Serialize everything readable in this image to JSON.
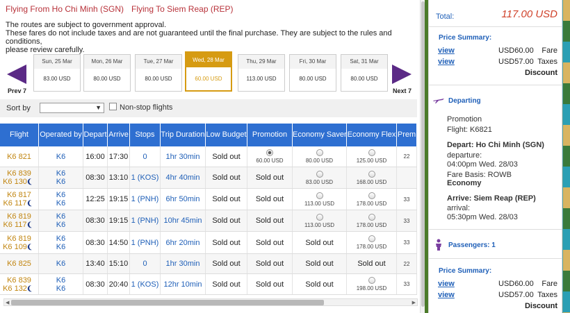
{
  "header": {
    "flying_from": "Flying From Ho Chi Minh (SGN)",
    "flying_to": "Flying To Siem Reap (REP)"
  },
  "notes": [
    "The routes are subject to government approval.",
    "These fares do not include taxes and are not guaranteed until the final purchase. They are subject to the rules and conditions,",
    "please review carefully."
  ],
  "date_nav": {
    "prev_label": "Prev 7",
    "next_label": "Next 7"
  },
  "dates": [
    {
      "day": "Sun, 25 Mar",
      "price": "83.00 USD"
    },
    {
      "day": "Mon, 26 Mar",
      "price": "80.00 USD"
    },
    {
      "day": "Tue, 27 Mar",
      "price": "80.00 USD"
    },
    {
      "day": "Wed, 28 Mar",
      "price": "60.00 USD",
      "selected": true
    },
    {
      "day": "Thu, 29 Mar",
      "price": "113.00 USD"
    },
    {
      "day": "Fri, 30 Mar",
      "price": "80.00 USD"
    },
    {
      "day": "Sat, 31 Mar",
      "price": "80.00 USD"
    }
  ],
  "sort": {
    "label": "Sort by",
    "value": "",
    "nonstop_label": "Non-stop flights"
  },
  "table": {
    "columns": [
      "Flight",
      "Operated by",
      "Depart",
      "Arrive",
      "Stops",
      "Trip Duration",
      "Low Budget",
      "Promotion",
      "Economy Saver",
      "Economy Flex",
      "Prem"
    ],
    "rows": [
      {
        "flights": [
          "K6 821"
        ],
        "ops": [
          "K6"
        ],
        "depart": "16:00",
        "arrive": "17:30",
        "stops": "0",
        "duration": "1hr 30min",
        "low": "Sold out",
        "promo": {
          "radio": "on",
          "price": "60.00 USD"
        },
        "saver": {
          "radio": "off",
          "price": "80.00 USD"
        },
        "flex": {
          "radio": "off",
          "price": "125.00 USD"
        },
        "prem": "22"
      },
      {
        "flights": [
          "K6 839",
          "K6 130"
        ],
        "night": [
          false,
          true
        ],
        "ops": [
          "K6",
          "K6"
        ],
        "depart": "08:30",
        "arrive": "13:10",
        "stops": "1 (KOS)",
        "duration": "4hr 40min",
        "low": "Sold out",
        "promo": {
          "text": "Sold out"
        },
        "saver": {
          "radio": "off",
          "price": "83.00 USD"
        },
        "flex": {
          "radio": "off",
          "price": "168.00 USD"
        },
        "prem": ""
      },
      {
        "flights": [
          "K6 817",
          "K6 117"
        ],
        "night": [
          false,
          true
        ],
        "ops": [
          "K6",
          "K6"
        ],
        "depart": "12:25",
        "arrive": "19:15",
        "stops": "1 (PNH)",
        "duration": "6hr 50min",
        "low": "Sold out",
        "promo": {
          "text": "Sold out"
        },
        "saver": {
          "radio": "off",
          "price": "113.00 USD"
        },
        "flex": {
          "radio": "off",
          "price": "178.00 USD"
        },
        "prem": "33"
      },
      {
        "flights": [
          "K6 819",
          "K6 117"
        ],
        "night": [
          false,
          true
        ],
        "ops": [
          "K6",
          "K6"
        ],
        "depart": "08:30",
        "arrive": "19:15",
        "stops": "1 (PNH)",
        "duration": "10hr 45min",
        "low": "Sold out",
        "promo": {
          "text": "Sold out"
        },
        "saver": {
          "radio": "off",
          "price": "113.00 USD"
        },
        "flex": {
          "radio": "off",
          "price": "178.00 USD"
        },
        "prem": "33"
      },
      {
        "flights": [
          "K6 819",
          "K6 109"
        ],
        "night": [
          false,
          true
        ],
        "ops": [
          "K6",
          "K6"
        ],
        "depart": "08:30",
        "arrive": "14:50",
        "stops": "1 (PNH)",
        "duration": "6hr 20min",
        "low": "Sold out",
        "promo": {
          "text": "Sold out"
        },
        "saver": {
          "text": "Sold out"
        },
        "flex": {
          "radio": "off",
          "price": "178.00 USD"
        },
        "prem": "33"
      },
      {
        "flights": [
          "K6 825"
        ],
        "ops": [
          "K6"
        ],
        "depart": "13:40",
        "arrive": "15:10",
        "stops": "0",
        "duration": "1hr 30min",
        "low": "Sold out",
        "promo": {
          "text": "Sold out"
        },
        "saver": {
          "text": "Sold out"
        },
        "flex": {
          "text": "Sold out"
        },
        "prem": "22"
      },
      {
        "flights": [
          "K6 839",
          "K6 132"
        ],
        "night": [
          false,
          true
        ],
        "ops": [
          "K6",
          "K6"
        ],
        "depart": "08:30",
        "arrive": "20:40",
        "stops": "1 (KOS)",
        "duration": "12hr 10min",
        "low": "Sold out",
        "promo": {
          "text": "Sold out"
        },
        "saver": {
          "text": "Sold out"
        },
        "flex": {
          "radio": "off",
          "price": "198.00 USD"
        },
        "prem": "33"
      }
    ]
  },
  "summary": {
    "total_label": "Total:",
    "total_value": "117.00 USD",
    "price_summary_label": "Price Summary:",
    "view_label": "view",
    "fare_amount": "USD60.00",
    "fare_label": "Fare",
    "tax_amount": "USD57.00",
    "tax_label": "Taxes",
    "discount_label": "Discount",
    "departing_label": "Departing",
    "promotion": "Promotion",
    "flight": "Flight: K6821",
    "depart_label": "Depart:",
    "depart_value": "Ho Chi Minh (SGN)",
    "departure_label": "departure:",
    "departure_time": "04:00pm Wed. 28/03",
    "fare_basis": "Fare Basis: ROWB",
    "cabin": "Economy",
    "arrive_label": "Arrive:",
    "arrive_value": "Siem Reap (REP)",
    "arrival_label": "arrival:",
    "arrival_time": "05:30pm Wed. 28/03",
    "passengers": "Passengers: 1"
  },
  "colors": {
    "accent": "#2e6fd1",
    "route": "#b8323a",
    "selected_date": "#d69b12",
    "total": "#d0422b",
    "arrow": "#5b2a86"
  }
}
